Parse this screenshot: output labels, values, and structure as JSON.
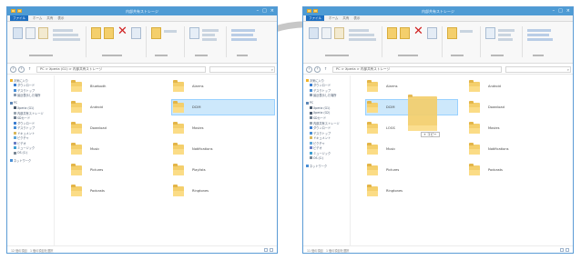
{
  "windows": [
    {
      "title": "内部共有ストレージ",
      "tabs": [
        "ファイル",
        "ホーム",
        "共有",
        "表示"
      ],
      "address": "PC > Xperia (G1) > 内部共有ストレージ",
      "nav_items": [
        {
          "label": "お気に入り",
          "icon": "star-icon",
          "type": "header"
        },
        {
          "label": "ダウンロード",
          "icon": "download-icon",
          "type": "item"
        },
        {
          "label": "デスクトップ",
          "icon": "desktop-icon",
          "type": "item"
        },
        {
          "label": "最近表示した場所",
          "icon": "recent-places-icon",
          "type": "item"
        },
        {
          "label": "PC",
          "icon": "pc-icon",
          "type": "header"
        },
        {
          "label": "Xperia (G1)",
          "icon": "phone-icon",
          "type": "item"
        },
        {
          "label": "内部共有ストレージ",
          "icon": "storage-icon",
          "type": "item"
        },
        {
          "label": "SDカード",
          "icon": "sd-card-icon",
          "type": "item"
        },
        {
          "label": "ダウンロード",
          "icon": "download-icon",
          "type": "item"
        },
        {
          "label": "デスクトップ",
          "icon": "desktop-icon",
          "type": "item"
        },
        {
          "label": "ドキュメント",
          "icon": "documents-icon",
          "type": "item"
        },
        {
          "label": "ピクチャ",
          "icon": "pictures-icon",
          "type": "item"
        },
        {
          "label": "ビデオ",
          "icon": "videos-icon",
          "type": "item"
        },
        {
          "label": "ミュージック",
          "icon": "music-icon",
          "type": "item"
        },
        {
          "label": "OS (C:)",
          "icon": "drive-icon",
          "type": "item"
        },
        {
          "label": "ネットワーク",
          "icon": "network-icon",
          "type": "header"
        }
      ],
      "files": [
        {
          "name": "Bluetooth",
          "col": 0,
          "row": 0,
          "selected": false
        },
        {
          "name": "Alarms",
          "col": 1,
          "row": 0,
          "selected": false
        },
        {
          "name": "Android",
          "col": 0,
          "row": 1,
          "selected": false
        },
        {
          "name": "DCIM",
          "col": 1,
          "row": 1,
          "selected": true
        },
        {
          "name": "Download",
          "col": 0,
          "row": 2,
          "selected": false
        },
        {
          "name": "Movies",
          "col": 1,
          "row": 2,
          "selected": false
        },
        {
          "name": "Music",
          "col": 0,
          "row": 3,
          "selected": false
        },
        {
          "name": "Notifications",
          "col": 1,
          "row": 3,
          "selected": false
        },
        {
          "name": "Pictures",
          "col": 0,
          "row": 4,
          "selected": false
        },
        {
          "name": "Playlists",
          "col": 1,
          "row": 4,
          "selected": false
        },
        {
          "name": "Podcasts",
          "col": 0,
          "row": 5,
          "selected": false
        },
        {
          "name": "Ringtones",
          "col": 1,
          "row": 5,
          "selected": false
        }
      ],
      "status": "12 個の項目　1 個の項目を選択"
    },
    {
      "title": "内部共有ストレージ",
      "tabs": [
        "ファイル",
        "ホーム",
        "共有",
        "表示"
      ],
      "address": "PC > Xperia > 内部共有ストレージ",
      "nav_items": [
        {
          "label": "お気に入り",
          "icon": "star-icon",
          "type": "header"
        },
        {
          "label": "ダウンロード",
          "icon": "download-icon",
          "type": "item"
        },
        {
          "label": "デスクトップ",
          "icon": "desktop-icon",
          "type": "item"
        },
        {
          "label": "最近表示した場所",
          "icon": "recent-places-icon",
          "type": "item"
        },
        {
          "label": "PC",
          "icon": "pc-icon",
          "type": "header"
        },
        {
          "label": "Xperia (G1)",
          "icon": "phone-icon",
          "type": "item"
        },
        {
          "label": "Xperia (G2)",
          "icon": "phone-icon",
          "type": "item"
        },
        {
          "label": "SDカード",
          "icon": "sd-card-icon",
          "type": "item"
        },
        {
          "label": "内部共有ストレージ",
          "icon": "storage-icon",
          "type": "item"
        },
        {
          "label": "ダウンロード",
          "icon": "download-icon",
          "type": "item"
        },
        {
          "label": "デスクトップ",
          "icon": "desktop-icon",
          "type": "item"
        },
        {
          "label": "ドキュメント",
          "icon": "documents-icon",
          "type": "item"
        },
        {
          "label": "ピクチャ",
          "icon": "pictures-icon",
          "type": "item"
        },
        {
          "label": "ビデオ",
          "icon": "videos-icon",
          "type": "item"
        },
        {
          "label": "ミュージック",
          "icon": "music-icon",
          "type": "item"
        },
        {
          "label": "OS (C:)",
          "icon": "drive-icon",
          "type": "item"
        },
        {
          "label": "ネットワーク",
          "icon": "network-icon",
          "type": "header"
        }
      ],
      "files": [
        {
          "name": "Alarms",
          "col": 0,
          "row": 0,
          "selected": false
        },
        {
          "name": "Android",
          "col": 1,
          "row": 0,
          "selected": false
        },
        {
          "name": "DCIM",
          "col": 0,
          "row": 1,
          "selected": true
        },
        {
          "name": "Download",
          "col": 1,
          "row": 1,
          "selected": false
        },
        {
          "name": "LOGS",
          "col": 0,
          "row": 2,
          "selected": false
        },
        {
          "name": "Movies",
          "col": 1,
          "row": 2,
          "selected": false
        },
        {
          "name": "Music",
          "col": 0,
          "row": 3,
          "selected": false
        },
        {
          "name": "Notifications",
          "col": 1,
          "row": 3,
          "selected": false
        },
        {
          "name": "Pictures",
          "col": 0,
          "row": 4,
          "selected": false
        },
        {
          "name": "Podcasts",
          "col": 1,
          "row": 4,
          "selected": false
        },
        {
          "name": "Ringtones",
          "col": 0,
          "row": 5,
          "selected": false
        }
      ],
      "status": "11 個の項目　1 個の項目を選択"
    }
  ],
  "drag": {
    "tooltip": "+ コピー"
  },
  "colors": {
    "titlebar": "#4e9bd4",
    "selection": "#cde8fb",
    "folder": "#f4cf6c",
    "arc": "#c7c7c7"
  }
}
